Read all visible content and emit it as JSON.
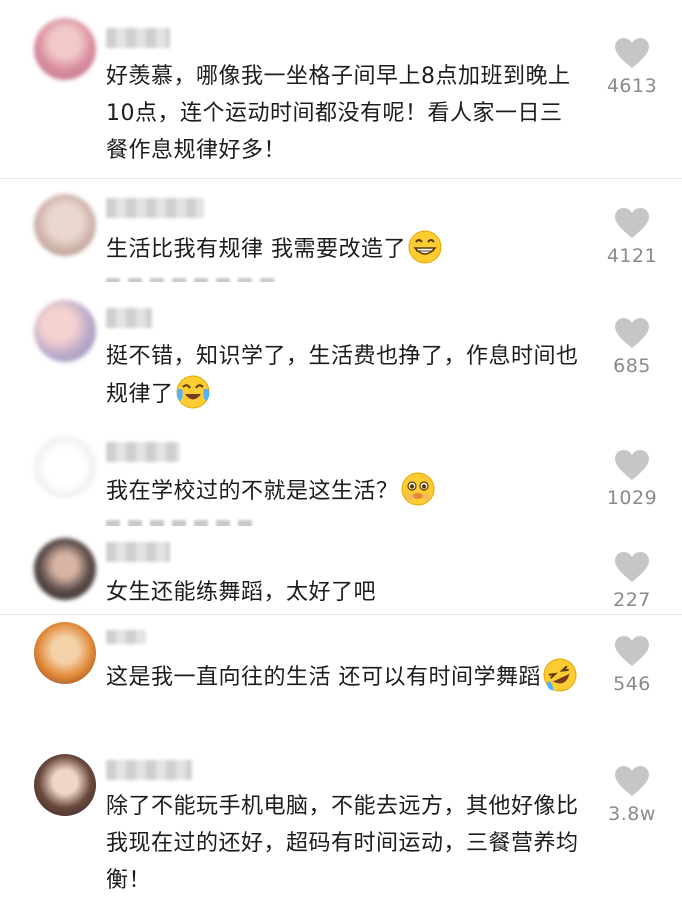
{
  "comments": [
    {
      "text": "好羡慕，哪像我一坐格子间早上8点加班到晚上10点，连个运动时间都没有呢！看人家一日三餐作息规律好多！",
      "likes": "4613",
      "emoji": ""
    },
    {
      "text": "生活比我有规律 我需要改造了",
      "likes": "4121",
      "emoji": "grin-emoji"
    },
    {
      "text": "挺不错，知识学了，生活费也挣了，作息时间也规律了",
      "likes": "685",
      "emoji": "tears-of-joy-emoji"
    },
    {
      "text": "我在学校过的不就是这生活？",
      "likes": "1029",
      "emoji": "pleading-face-emoji"
    },
    {
      "text": "女生还能练舞蹈，太好了吧",
      "likes": "227",
      "emoji": ""
    },
    {
      "text": "这是我一直向往的生活 还可以有时间学舞蹈",
      "likes": "546",
      "emoji": "rolling-laughing-emoji"
    },
    {
      "text": "除了不能玩手机电脑，不能去远方，其他好像比我现在过的还好，超码有时间运动，三餐营养均衡！",
      "likes": "3.8w",
      "emoji": ""
    }
  ],
  "colors": {
    "heart": "#c6c6c6",
    "count": "#8a8a8a",
    "text": "#1c1c1c",
    "divider": "#e9e9e9"
  }
}
